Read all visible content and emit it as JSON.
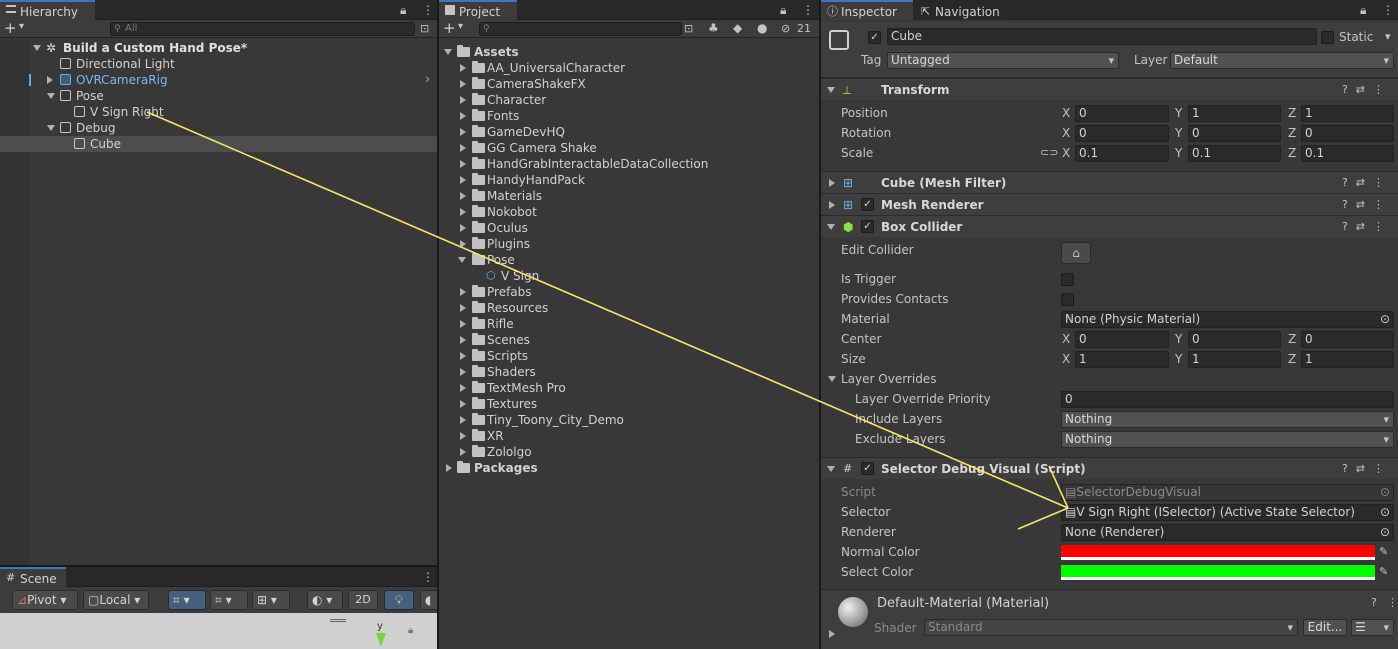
{
  "hierarchy": {
    "tab_label": "Hierarchy",
    "search_placeholder": "All",
    "items": [
      {
        "label": "Build a Custom Hand Pose*"
      },
      {
        "label": "Directional Light"
      },
      {
        "label": "OVRCameraRig"
      },
      {
        "label": "Pose"
      },
      {
        "label": "V Sign Right"
      },
      {
        "label": "Debug"
      },
      {
        "label": "Cube"
      }
    ]
  },
  "scene": {
    "tab_label": "Scene",
    "pivot_label": "Pivot",
    "local_label": "Local",
    "mode_2d": "2D",
    "gizmo_y": "y"
  },
  "project": {
    "tab_label": "Project",
    "hidden_count": "21",
    "root_assets": "Assets",
    "folders": [
      "AA_UniversalCharacter",
      "CameraShakeFX",
      "Character",
      "Fonts",
      "GameDevHQ",
      "GG Camera Shake",
      "HandGrabInteractableDataCollection",
      "HandyHandPack",
      "Materials",
      "Nokobot",
      "Oculus",
      "Plugins",
      "Pose",
      "V Sign",
      "Prefabs",
      "Resources",
      "Rifle",
      "Scenes",
      "Scripts",
      "Shaders",
      "TextMesh Pro",
      "Textures",
      "Tiny_Toony_City_Demo",
      "XR",
      "Zololgo"
    ],
    "root_packages": "Packages"
  },
  "inspector": {
    "tab_label": "Inspector",
    "nav_tab_label": "Navigation",
    "object_name": "Cube",
    "static_label": "Static",
    "tag_label": "Tag",
    "tag_value": "Untagged",
    "layer_label": "Layer",
    "layer_value": "Default",
    "transform": {
      "title": "Transform",
      "position_label": "Position",
      "rotation_label": "Rotation",
      "scale_label": "Scale",
      "position": {
        "x": "0",
        "y": "1",
        "z": "1"
      },
      "rotation": {
        "x": "0",
        "y": "0",
        "z": "0"
      },
      "scale": {
        "x": "0.1",
        "y": "0.1",
        "z": "0.1"
      }
    },
    "axis": {
      "x": "X",
      "y": "Y",
      "z": "Z"
    },
    "mesh_filter_title": "Cube (Mesh Filter)",
    "mesh_renderer_title": "Mesh Renderer",
    "box_collider": {
      "title": "Box Collider",
      "edit_collider_label": "Edit Collider",
      "is_trigger_label": "Is Trigger",
      "provides_contacts_label": "Provides Contacts",
      "material_label": "Material",
      "material_value": "None (Physic Material)",
      "center_label": "Center",
      "center": {
        "x": "0",
        "y": "0",
        "z": "0"
      },
      "size_label": "Size",
      "size": {
        "x": "1",
        "y": "1",
        "z": "1"
      },
      "layer_overrides_label": "Layer Overrides",
      "priority_label": "Layer Override Priority",
      "priority_value": "0",
      "include_label": "Include Layers",
      "include_value": "Nothing",
      "exclude_label": "Exclude Layers",
      "exclude_value": "Nothing"
    },
    "selector_debug": {
      "title": "Selector Debug Visual (Script)",
      "script_label": "Script",
      "script_value": "SelectorDebugVisual",
      "selector_label": "Selector",
      "selector_value": "V Sign Right (ISelector) (Active State Selector)",
      "renderer_label": "Renderer",
      "renderer_value": "None (Renderer)",
      "normal_color_label": "Normal Color",
      "normal_color": "#ff0000",
      "select_color_label": "Select Color",
      "select_color": "#00ff00"
    },
    "material": {
      "title": "Default-Material (Material)",
      "shader_label": "Shader",
      "shader_value": "Standard",
      "edit_label": "Edit..."
    }
  },
  "colors": {
    "accent": "#3a79bb",
    "annotation_line": "#f5e66a",
    "prefab_blue": "#5cb0f0"
  }
}
